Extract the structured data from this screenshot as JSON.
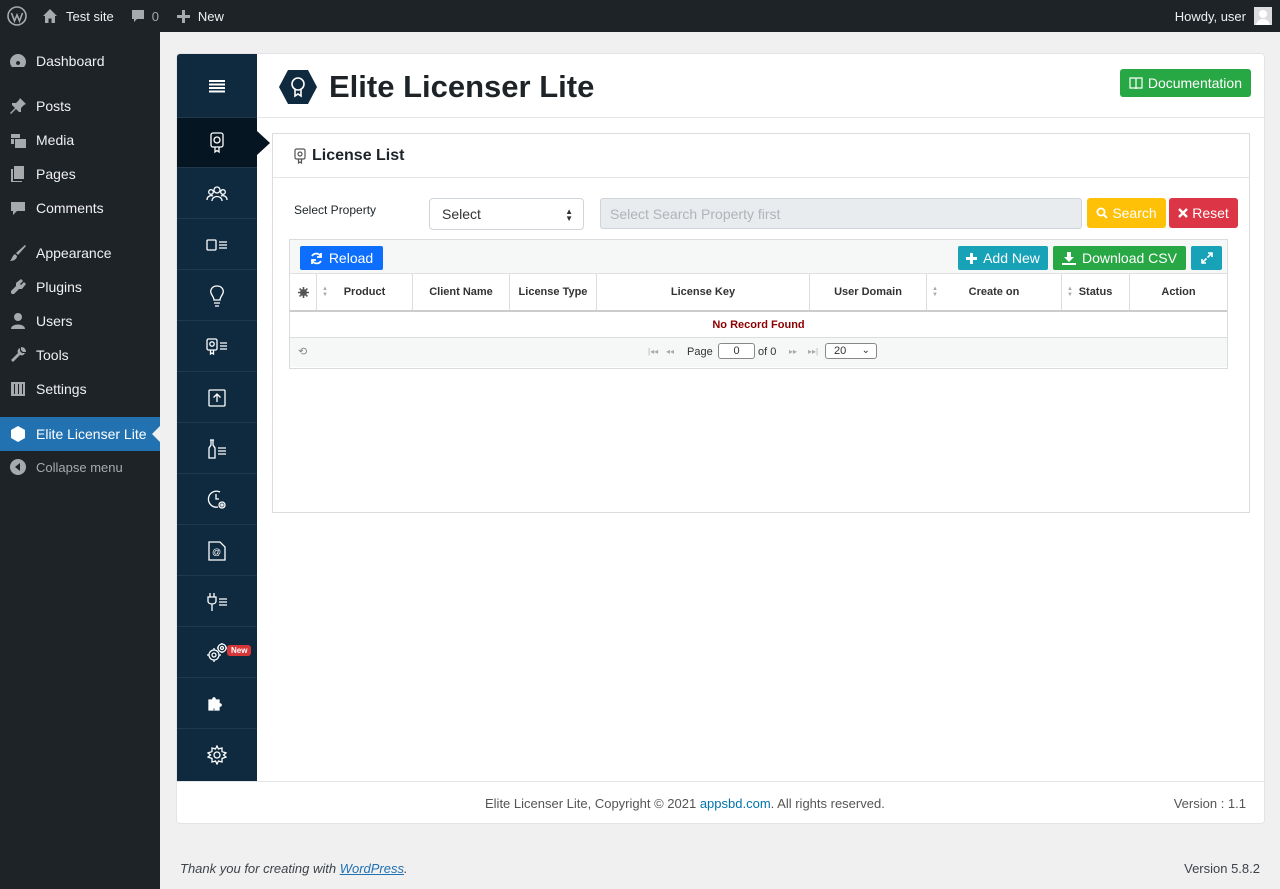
{
  "admin_bar": {
    "site_name": "Test site",
    "comments_count": "0",
    "new_label": "New",
    "howdy": "Howdy, user"
  },
  "wp_menu": {
    "items": [
      {
        "label": "Dashboard",
        "icon": "dashboard-icon"
      },
      {
        "label": "Posts",
        "icon": "pin-icon"
      },
      {
        "label": "Media",
        "icon": "media-icon"
      },
      {
        "label": "Pages",
        "icon": "pages-icon"
      },
      {
        "label": "Comments",
        "icon": "comment-icon"
      },
      {
        "label": "Appearance",
        "icon": "brush-icon"
      },
      {
        "label": "Plugins",
        "icon": "plugin-icon"
      },
      {
        "label": "Users",
        "icon": "user-icon"
      },
      {
        "label": "Tools",
        "icon": "wrench-icon"
      },
      {
        "label": "Settings",
        "icon": "settings-sliders-icon"
      },
      {
        "label": "Elite Licenser Lite",
        "icon": "elite-licenser-icon",
        "current": true
      }
    ],
    "collapse_label": "Collapse menu"
  },
  "plugin": {
    "title": "Elite Licenser Lite",
    "documentation_label": "Documentation",
    "side_nav_icons": [
      "menu-icon",
      "license-certificate-icon",
      "clients-group-icon",
      "product-list-icon",
      "lightbulb-idea-icon",
      "license-list-icon",
      "upload-icon",
      "bottle-list-icon",
      "clock-settings-icon",
      "email-at-icon",
      "plug-list-icon",
      "gears-icon",
      "puzzle-icon",
      "settings-gear-icon"
    ],
    "new_badge": "New",
    "card_title": "License List",
    "filter": {
      "label": "Select Property",
      "select_value": "Select",
      "search_placeholder": "Select Search Property first",
      "search_label": "Search",
      "reset_label": "Reset"
    },
    "grid": {
      "reload_label": "Reload",
      "add_new_label": "Add New",
      "download_csv_label": "Download CSV",
      "columns": [
        "Product",
        "Client Name",
        "License Type",
        "License Key",
        "User Domain",
        "Create on",
        "Status",
        "Action"
      ],
      "empty_message": "No Record Found",
      "pager": {
        "page_label": "Page",
        "page_value": "0",
        "of_label": "of 0",
        "page_size": "20"
      }
    },
    "footer": {
      "copyright_prefix": "Elite Licenser Lite, Copyright © 2021",
      "link_text": "appsbd.com",
      "copyright_suffix": ". All rights reserved.",
      "version": "Version : 1.1"
    }
  },
  "wp_footer": {
    "thanks_prefix": "Thank you for creating with",
    "wordpress_link": "WordPress",
    "thanks_suffix": ".",
    "version": "Version 5.8.2"
  },
  "colors": {
    "admin_bar": "#1d2327",
    "menu_current": "#2271b1",
    "plugin_sidebar": "#0f2a3f",
    "doc_button": "#28a745",
    "search_button": "#ffc107",
    "reset_button": "#dc3545",
    "reload_button": "#0d6efd",
    "add_new_button": "#17a2b8"
  }
}
